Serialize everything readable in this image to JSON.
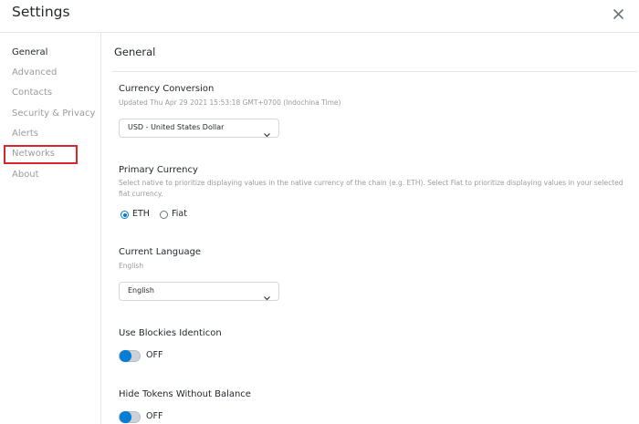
{
  "header": {
    "title": "Settings",
    "close_icon": "close-icon"
  },
  "sidebar": {
    "items": [
      {
        "label": "General",
        "active": true
      },
      {
        "label": "Advanced",
        "active": false
      },
      {
        "label": "Contacts",
        "active": false
      },
      {
        "label": "Security & Privacy",
        "active": false
      },
      {
        "label": "Alerts",
        "active": false
      },
      {
        "label": "Networks",
        "active": false,
        "highlighted": true
      },
      {
        "label": "About",
        "active": false
      }
    ]
  },
  "main": {
    "section_title": "General",
    "currency": {
      "title": "Currency Conversion",
      "description": "Updated Thu Apr 29 2021 15:53:18 GMT+0700 (Indochina Time)",
      "selected": "USD - United States Dollar"
    },
    "primary_currency": {
      "title": "Primary Currency",
      "description": "Select native to prioritize displaying values in the native currency of the chain (e.g. ETH). Select Fiat to prioritize displaying values in your selected fiat currency.",
      "options": [
        {
          "label": "ETH",
          "checked": true
        },
        {
          "label": "Fiat",
          "checked": false
        }
      ]
    },
    "language": {
      "title": "Current Language",
      "description": "English",
      "selected": "English"
    },
    "blockies": {
      "title": "Use Blockies Identicon",
      "state": "OFF"
    },
    "hide_tokens": {
      "title": "Hide Tokens Without Balance",
      "state": "OFF"
    }
  },
  "colors": {
    "accent": "#037dd6",
    "highlight_box": "#d7262d",
    "muted_text": "#9b9b9b",
    "primary_text": "#24292e"
  }
}
